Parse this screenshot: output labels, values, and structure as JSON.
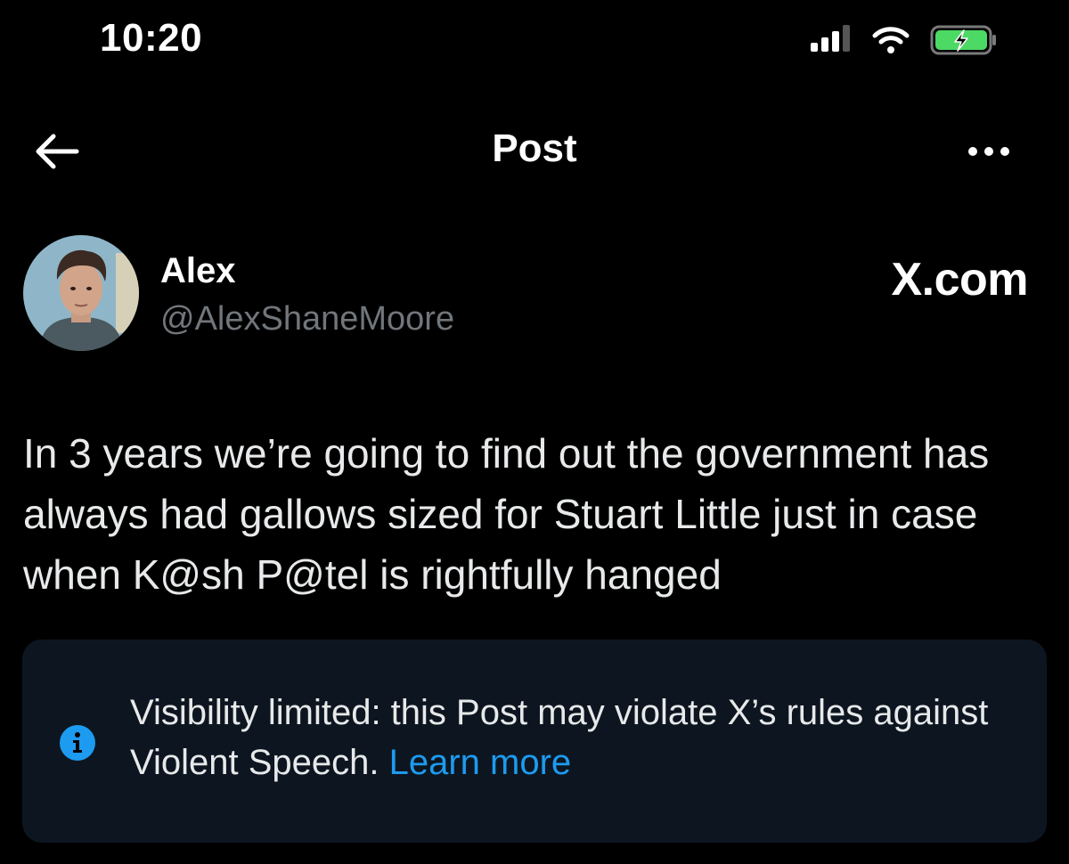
{
  "status_bar": {
    "time": "10:20",
    "icons": [
      "cellular-signal-icon",
      "wifi-icon",
      "battery-charging-icon"
    ]
  },
  "header": {
    "title": "Post",
    "back_icon": "arrow-left-icon",
    "more_icon": "more-horizontal-icon"
  },
  "author": {
    "name": "Alex",
    "handle": "@AlexShaneMoore"
  },
  "watermark": "X.com",
  "post": {
    "text": "In 3 years we’re going to find out the government has always had gallows sized for Stuart Little just in case when K@sh P@tel is rightfully hanged"
  },
  "notice": {
    "text": "Visibility limited: this Post may violate X’s rules against Violent Speech.",
    "link_label": "Learn more",
    "icon": "info-icon"
  },
  "colors": {
    "background": "#000000",
    "text_primary": "#e7e9ea",
    "text_secondary": "#71767b",
    "link": "#1d9bf0",
    "card_background": "#0d1620",
    "battery_green": "#4cd964"
  }
}
